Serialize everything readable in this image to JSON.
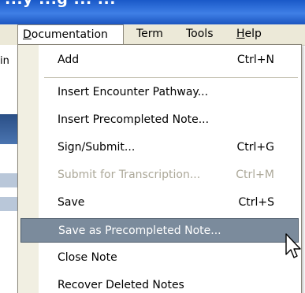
{
  "title_fragment": "...y ...g ... ...",
  "menubar": {
    "items": [
      {
        "label": "ocumentation",
        "accel": "D",
        "open": true
      },
      {
        "label": "Term",
        "accel": "",
        "open": false
      },
      {
        "label": "Tools",
        "accel": "",
        "open": false
      },
      {
        "label": "elp",
        "accel": "H",
        "open": false
      }
    ]
  },
  "background_fragment": "in",
  "menu": {
    "items": [
      {
        "label": "Add",
        "shortcut": "Ctrl+N",
        "disabled": false,
        "highlighted": false
      },
      {
        "label": "Insert Encounter Pathway...",
        "shortcut": "",
        "disabled": false,
        "highlighted": false
      },
      {
        "label": "Insert Precompleted Note...",
        "shortcut": "",
        "disabled": false,
        "highlighted": false
      },
      {
        "label": "Sign/Submit...",
        "shortcut": "Ctrl+G",
        "disabled": false,
        "highlighted": false
      },
      {
        "label": "Submit for Transcription...",
        "shortcut": "Ctrl+M",
        "disabled": true,
        "highlighted": false
      },
      {
        "label": "Save",
        "shortcut": "Ctrl+S",
        "disabled": false,
        "highlighted": false
      },
      {
        "label": "Save as Precompleted Note...",
        "shortcut": "",
        "disabled": false,
        "highlighted": true
      },
      {
        "label": "Close Note",
        "shortcut": "",
        "disabled": false,
        "highlighted": false
      },
      {
        "label": "Recover Deleted Notes",
        "shortcut": "",
        "disabled": false,
        "highlighted": false
      }
    ]
  },
  "colors": {
    "title_bar": "#3f7fe6",
    "menubar_bg": "#ece9d8",
    "highlight_bg": "#7b8b9c",
    "disabled_text": "#aca899"
  },
  "icons": {
    "cursor": "mouse-pointer-icon"
  }
}
